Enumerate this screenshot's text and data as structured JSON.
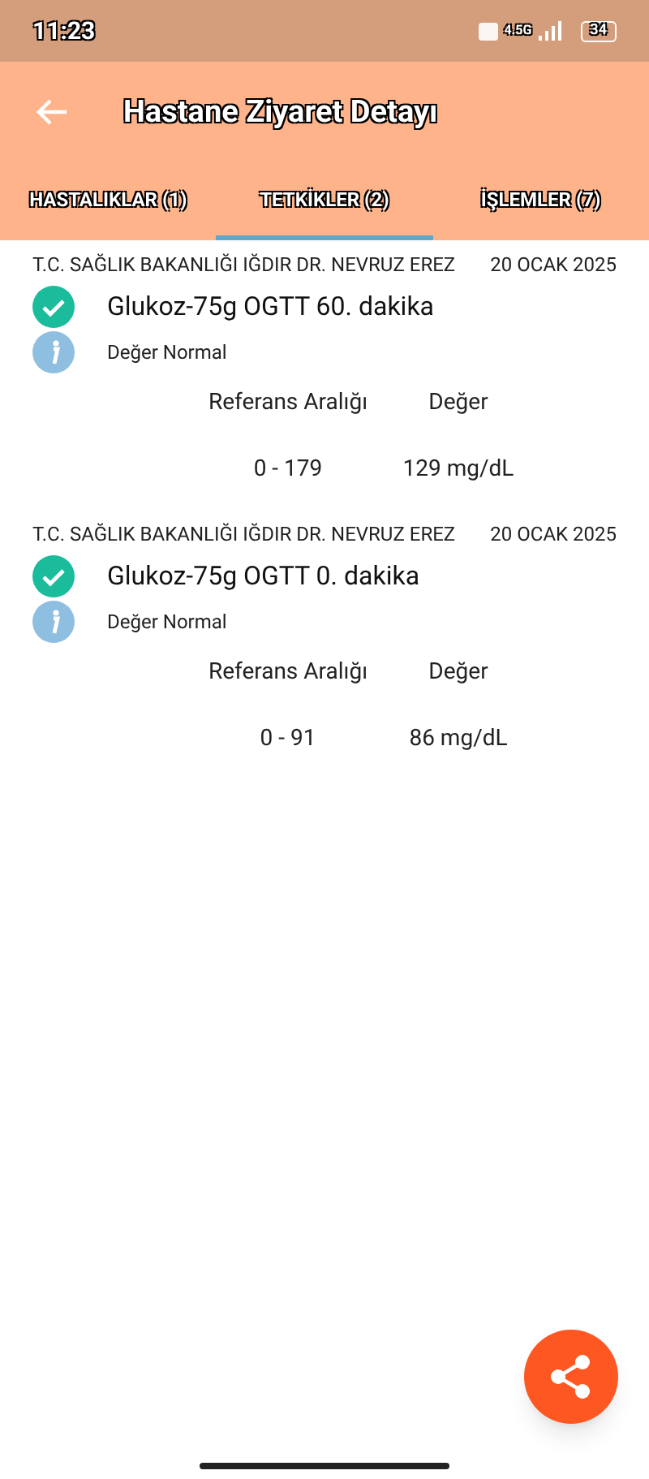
{
  "status_bar": {
    "time": "11:23",
    "network": "4.5G",
    "battery": "34"
  },
  "app_bar": {
    "title": "Hastane Ziyaret Detayı"
  },
  "tabs": [
    {
      "label": "HASTALIKLAR (1)",
      "selected": false
    },
    {
      "label": "TETKİKLER (2)",
      "selected": true
    },
    {
      "label": "İŞLEMLER (7)",
      "selected": false
    }
  ],
  "results": [
    {
      "institution": "T.C. SAĞLIK BAKANLIĞI IĞDIR DR. NEVRUZ EREZ",
      "date": "20 OCAK 2025",
      "test": "Glukoz-75g OGTT 60. dakika",
      "status": "Değer Normal",
      "reference_header": "Referans Aralığı",
      "value_header": "Değer",
      "reference": "0 - 179",
      "value": "129 mg/dL"
    },
    {
      "institution": "T.C. SAĞLIK BAKANLIĞI IĞDIR DR. NEVRUZ EREZ",
      "date": "20 OCAK 2025",
      "test": "Glukoz-75g OGTT 0. dakika",
      "status": "Değer Normal",
      "reference_header": "Referans Aralığı",
      "value_header": "Değer",
      "reference": "0 - 91",
      "value": "86 mg/dL"
    }
  ]
}
